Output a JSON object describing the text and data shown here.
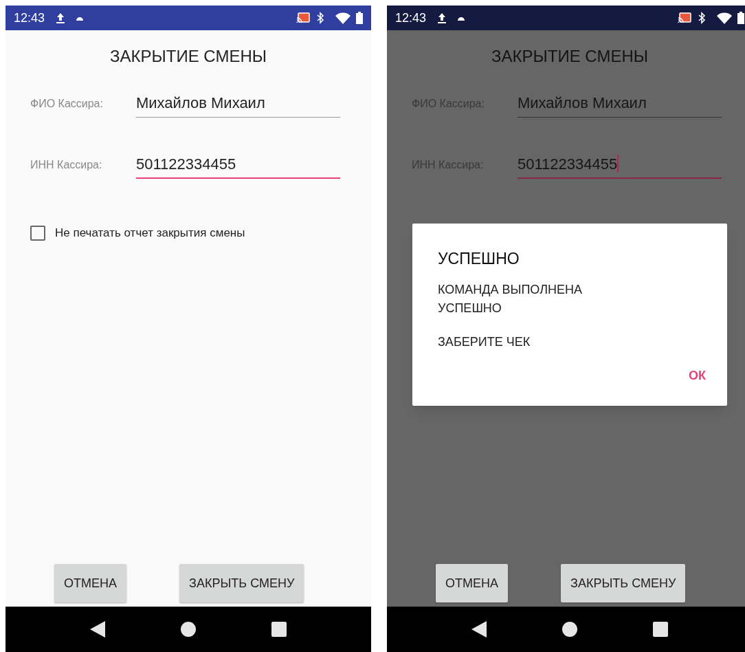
{
  "screens": [
    {
      "dimmed": false,
      "status_bar": {
        "time": "12:43"
      },
      "title": "ЗАКРЫТИЕ СМЕНЫ",
      "fields": [
        {
          "label": "ФИО Кассира:",
          "value": "Михайлов Михаил",
          "focused": false,
          "cursor": false
        },
        {
          "label": "ИНН Кассира:",
          "value": "501122334455",
          "focused": true,
          "cursor": false
        }
      ],
      "checkbox": {
        "label": "Не печатать отчет закрытия смены",
        "checked": false
      },
      "buttons": [
        "ОТМЕНА",
        "ЗАКРЫТЬ СМЕНУ"
      ]
    },
    {
      "dimmed": true,
      "status_bar": {
        "time": "12:43"
      },
      "title": "ЗАКРЫТИЕ СМЕНЫ",
      "fields": [
        {
          "label": "ФИО Кассира:",
          "value": "Михайлов Михаил",
          "focused": false,
          "cursor": false
        },
        {
          "label": "ИНН Кассира:",
          "value": "501122334455",
          "focused": true,
          "cursor": true
        }
      ],
      "buttons": [
        "ОТМЕНА",
        "ЗАКРЫТЬ СМЕНУ"
      ],
      "dialog": {
        "title": "УСПЕШНО",
        "lines": [
          "КОМАНДА ВЫПОЛНЕНА УСПЕШНО",
          "ЗАБЕРИТЕ ЧЕК"
        ],
        "button": "ОК"
      }
    }
  ]
}
